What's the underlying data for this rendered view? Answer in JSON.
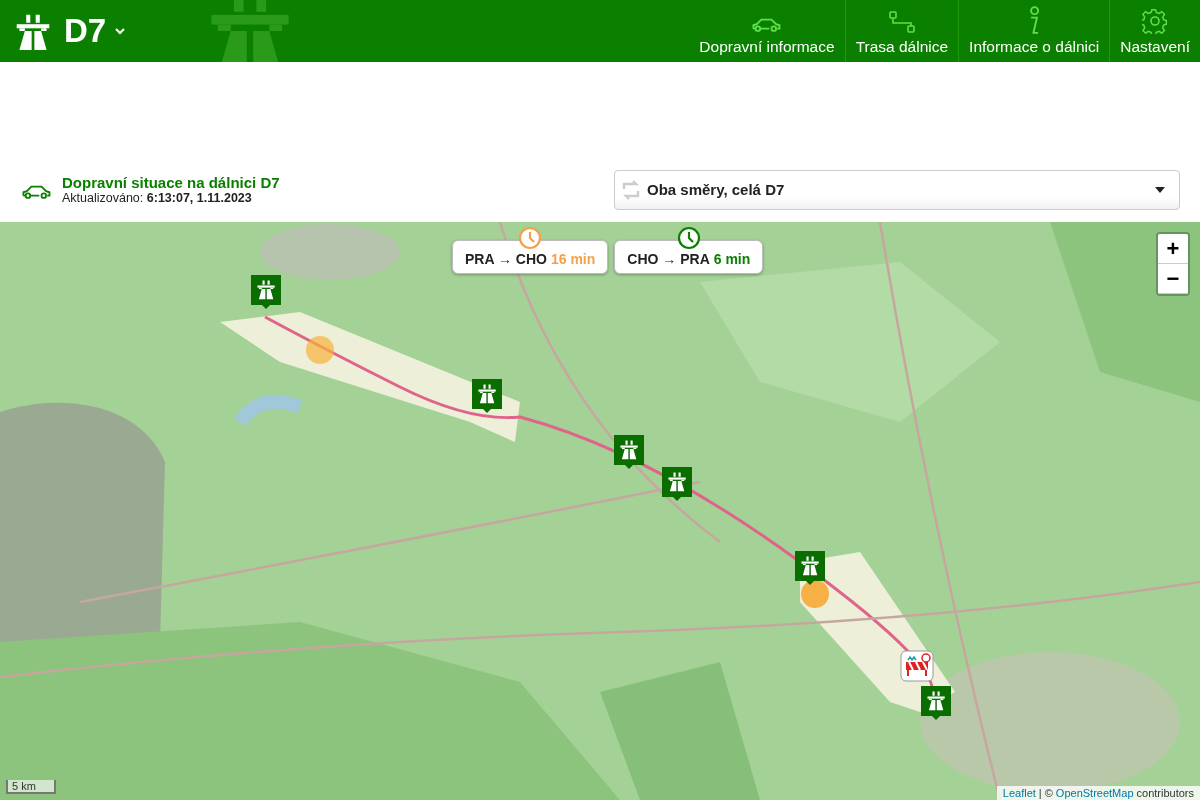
{
  "header": {
    "title": "D7",
    "nav": [
      {
        "label": "Dopravní informace",
        "kind": "car"
      },
      {
        "label": "Trasa dálnice",
        "kind": "route"
      },
      {
        "label": "Informace o dálnici",
        "kind": "info"
      },
      {
        "label": "Nastavení",
        "kind": "gear"
      }
    ]
  },
  "situation": {
    "title": "Dopravní situace na dálnici D7",
    "updated": "Aktualizováno: **6:13:07, 1.11.2023**"
  },
  "direction_select": {
    "value": "Oba směry, celá D7"
  },
  "map": {
    "kind": "picture",
    "travel_times": [
      {
        "route": "PRA → CHO",
        "time": "16 min",
        "color": "#f5a04a"
      },
      {
        "route": "CHO → PRA",
        "time": "6 min",
        "color": "#0b8000"
      }
    ],
    "markers": [
      {
        "kind": "highway"
      },
      {
        "kind": "highway"
      },
      {
        "kind": "highway"
      },
      {
        "kind": "highway"
      },
      {
        "kind": "highway"
      },
      {
        "kind": "roadwork"
      },
      {
        "kind": "highway"
      }
    ],
    "zoom": [
      "+",
      "−"
    ],
    "scale": "5 km",
    "attribution": {
      "links": [
        "Leaflet",
        "OpenStreetMap"
      ],
      "separator": "| ©",
      "suffix": "contributors"
    }
  }
}
